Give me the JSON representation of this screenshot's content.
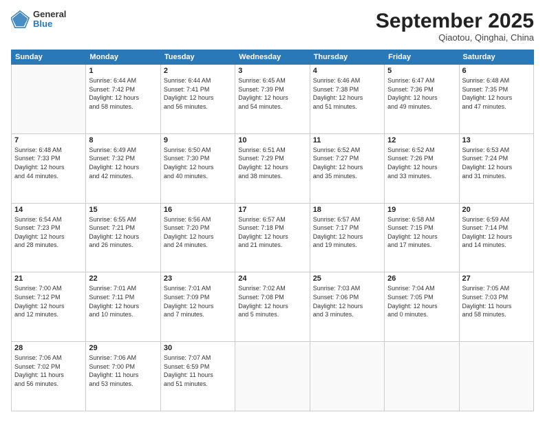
{
  "header": {
    "logo_general": "General",
    "logo_blue": "Blue",
    "month_title": "September 2025",
    "subtitle": "Qiaotou, Qinghai, China"
  },
  "days_of_week": [
    "Sunday",
    "Monday",
    "Tuesday",
    "Wednesday",
    "Thursday",
    "Friday",
    "Saturday"
  ],
  "weeks": [
    [
      {
        "day": "",
        "info": ""
      },
      {
        "day": "1",
        "info": "Sunrise: 6:44 AM\nSunset: 7:42 PM\nDaylight: 12 hours\nand 58 minutes."
      },
      {
        "day": "2",
        "info": "Sunrise: 6:44 AM\nSunset: 7:41 PM\nDaylight: 12 hours\nand 56 minutes."
      },
      {
        "day": "3",
        "info": "Sunrise: 6:45 AM\nSunset: 7:39 PM\nDaylight: 12 hours\nand 54 minutes."
      },
      {
        "day": "4",
        "info": "Sunrise: 6:46 AM\nSunset: 7:38 PM\nDaylight: 12 hours\nand 51 minutes."
      },
      {
        "day": "5",
        "info": "Sunrise: 6:47 AM\nSunset: 7:36 PM\nDaylight: 12 hours\nand 49 minutes."
      },
      {
        "day": "6",
        "info": "Sunrise: 6:48 AM\nSunset: 7:35 PM\nDaylight: 12 hours\nand 47 minutes."
      }
    ],
    [
      {
        "day": "7",
        "info": "Sunrise: 6:48 AM\nSunset: 7:33 PM\nDaylight: 12 hours\nand 44 minutes."
      },
      {
        "day": "8",
        "info": "Sunrise: 6:49 AM\nSunset: 7:32 PM\nDaylight: 12 hours\nand 42 minutes."
      },
      {
        "day": "9",
        "info": "Sunrise: 6:50 AM\nSunset: 7:30 PM\nDaylight: 12 hours\nand 40 minutes."
      },
      {
        "day": "10",
        "info": "Sunrise: 6:51 AM\nSunset: 7:29 PM\nDaylight: 12 hours\nand 38 minutes."
      },
      {
        "day": "11",
        "info": "Sunrise: 6:52 AM\nSunset: 7:27 PM\nDaylight: 12 hours\nand 35 minutes."
      },
      {
        "day": "12",
        "info": "Sunrise: 6:52 AM\nSunset: 7:26 PM\nDaylight: 12 hours\nand 33 minutes."
      },
      {
        "day": "13",
        "info": "Sunrise: 6:53 AM\nSunset: 7:24 PM\nDaylight: 12 hours\nand 31 minutes."
      }
    ],
    [
      {
        "day": "14",
        "info": "Sunrise: 6:54 AM\nSunset: 7:23 PM\nDaylight: 12 hours\nand 28 minutes."
      },
      {
        "day": "15",
        "info": "Sunrise: 6:55 AM\nSunset: 7:21 PM\nDaylight: 12 hours\nand 26 minutes."
      },
      {
        "day": "16",
        "info": "Sunrise: 6:56 AM\nSunset: 7:20 PM\nDaylight: 12 hours\nand 24 minutes."
      },
      {
        "day": "17",
        "info": "Sunrise: 6:57 AM\nSunset: 7:18 PM\nDaylight: 12 hours\nand 21 minutes."
      },
      {
        "day": "18",
        "info": "Sunrise: 6:57 AM\nSunset: 7:17 PM\nDaylight: 12 hours\nand 19 minutes."
      },
      {
        "day": "19",
        "info": "Sunrise: 6:58 AM\nSunset: 7:15 PM\nDaylight: 12 hours\nand 17 minutes."
      },
      {
        "day": "20",
        "info": "Sunrise: 6:59 AM\nSunset: 7:14 PM\nDaylight: 12 hours\nand 14 minutes."
      }
    ],
    [
      {
        "day": "21",
        "info": "Sunrise: 7:00 AM\nSunset: 7:12 PM\nDaylight: 12 hours\nand 12 minutes."
      },
      {
        "day": "22",
        "info": "Sunrise: 7:01 AM\nSunset: 7:11 PM\nDaylight: 12 hours\nand 10 minutes."
      },
      {
        "day": "23",
        "info": "Sunrise: 7:01 AM\nSunset: 7:09 PM\nDaylight: 12 hours\nand 7 minutes."
      },
      {
        "day": "24",
        "info": "Sunrise: 7:02 AM\nSunset: 7:08 PM\nDaylight: 12 hours\nand 5 minutes."
      },
      {
        "day": "25",
        "info": "Sunrise: 7:03 AM\nSunset: 7:06 PM\nDaylight: 12 hours\nand 3 minutes."
      },
      {
        "day": "26",
        "info": "Sunrise: 7:04 AM\nSunset: 7:05 PM\nDaylight: 12 hours\nand 0 minutes."
      },
      {
        "day": "27",
        "info": "Sunrise: 7:05 AM\nSunset: 7:03 PM\nDaylight: 11 hours\nand 58 minutes."
      }
    ],
    [
      {
        "day": "28",
        "info": "Sunrise: 7:06 AM\nSunset: 7:02 PM\nDaylight: 11 hours\nand 56 minutes."
      },
      {
        "day": "29",
        "info": "Sunrise: 7:06 AM\nSunset: 7:00 PM\nDaylight: 11 hours\nand 53 minutes."
      },
      {
        "day": "30",
        "info": "Sunrise: 7:07 AM\nSunset: 6:59 PM\nDaylight: 11 hours\nand 51 minutes."
      },
      {
        "day": "",
        "info": ""
      },
      {
        "day": "",
        "info": ""
      },
      {
        "day": "",
        "info": ""
      },
      {
        "day": "",
        "info": ""
      }
    ]
  ]
}
